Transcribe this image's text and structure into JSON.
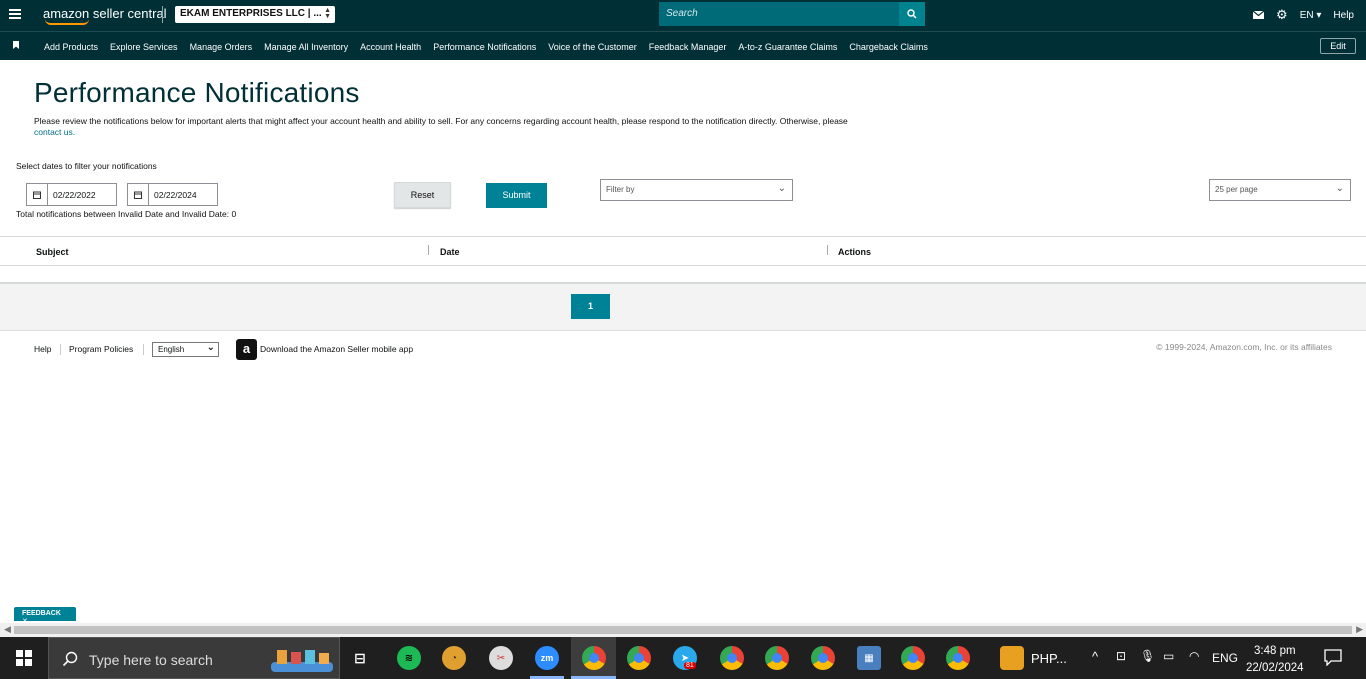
{
  "header": {
    "logo_text": "amazon seller central",
    "account_selector": "EKAM ENTERPRISES LLC | ...",
    "search_placeholder": "Search",
    "language": "EN",
    "help": "Help"
  },
  "nav": {
    "items": [
      "Add Products",
      "Explore Services",
      "Manage Orders",
      "Manage All Inventory",
      "Account Health",
      "Performance Notifications",
      "Voice of the Customer",
      "Feedback Manager",
      "A-to-z Guarantee Claims",
      "Chargeback Claims"
    ],
    "edit": "Edit"
  },
  "page": {
    "title": "Performance Notifications",
    "description": "Please review the notifications below for important alerts that might affect your account health and ability to sell. For any concerns regarding account health, please respond to the notification directly. Otherwise, please",
    "contact_link": "contact us.",
    "filter_label": "Select dates to filter your notifications",
    "start_date": "02/22/2022",
    "end_date": "02/22/2024",
    "reset": "Reset",
    "submit": "Submit",
    "filter_by_placeholder": "Filter by",
    "per_page": "25 per page",
    "total_text": "Total notifications between Invalid Date and Invalid Date: 0"
  },
  "table": {
    "columns": [
      "Subject",
      "Date",
      "Actions"
    ]
  },
  "pager": {
    "current_page": "1"
  },
  "footer": {
    "help": "Help",
    "program_policies": "Program Policies",
    "language": "English",
    "mobile_app": "Download the Amazon Seller mobile app",
    "copyright": "© 1999-2024, Amazon.com, Inc. or its affiliates"
  },
  "feedback": "FEEDBACK ✕",
  "taskbar": {
    "search_placeholder": "Type here to search",
    "telegram_badge": "81",
    "app_label": "PHP...",
    "lang": "ENG",
    "time": "3:48 pm",
    "date": "22/02/2024"
  },
  "colors": {
    "header_bg": "#002f36",
    "accent_teal": "#008296",
    "search_bg": "#006b78"
  }
}
